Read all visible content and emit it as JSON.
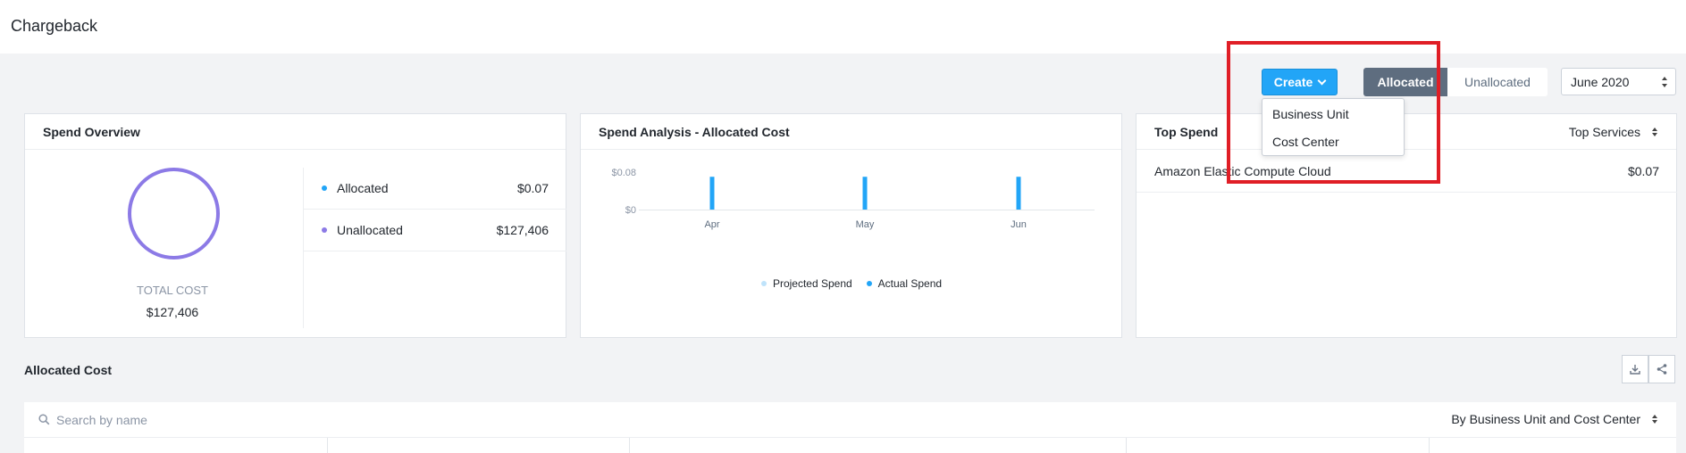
{
  "page": {
    "title": "Chargeback"
  },
  "toolbar": {
    "create_label": "Create",
    "create_menu": [
      "Business Unit",
      "Cost Center"
    ],
    "toggle": {
      "active": "Allocated",
      "inactive": "Unallocated"
    },
    "month": "June 2020"
  },
  "spend_overview": {
    "title": "Spend Overview",
    "total_label": "TOTAL COST",
    "total_value": "$127,406",
    "rows": [
      {
        "name": "Allocated",
        "value": "$0.07",
        "color": "#22a5f7"
      },
      {
        "name": "Unallocated",
        "value": "$127,406",
        "color": "#8c7ae6"
      }
    ],
    "donut_color": "#8c7ae6"
  },
  "spend_analysis": {
    "title": "Spend Analysis - Allocated Cost",
    "legend": [
      {
        "name": "Projected Spend",
        "color": "#bfe3fb"
      },
      {
        "name": "Actual Spend",
        "color": "#22a5f7"
      }
    ]
  },
  "chart_data": {
    "type": "bar",
    "title": "Spend Analysis - Allocated Cost",
    "categories": [
      "Apr",
      "May",
      "Jun"
    ],
    "series": [
      {
        "name": "Actual Spend",
        "values": [
          0.07,
          0.07,
          0.07
        ]
      }
    ],
    "ylim": [
      0,
      0.08
    ],
    "yticks": [
      "$0.08",
      "$0"
    ],
    "bar_color": "#22a5f7",
    "legend": "bottom",
    "grid": false
  },
  "top_spend": {
    "title": "Top Spend",
    "select": "Top Services",
    "rows": [
      {
        "name": "Amazon Elastic Compute Cloud",
        "value": "$0.07"
      }
    ]
  },
  "allocated_cost": {
    "title": "Allocated Cost",
    "search_placeholder": "Search by name",
    "group_by": "By Business Unit and Cost Center"
  },
  "colors": {
    "accent": "#22a5f7",
    "highlight": "#e01e26",
    "toggle_active": "#5e6d7f"
  }
}
